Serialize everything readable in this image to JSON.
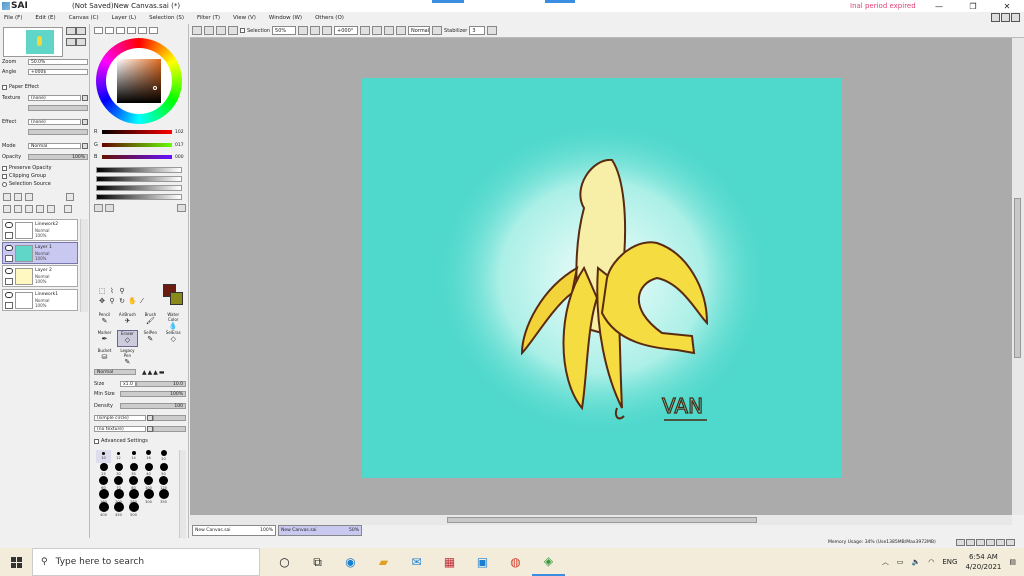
{
  "app": {
    "brand": "SAI",
    "title": "(Not Saved)New Canvas.sai (*)",
    "trial_notice": "Inal period expired",
    "min": "—",
    "max": "❐",
    "close": "✕"
  },
  "menu": [
    "File (F)",
    "Edit (E)",
    "Canvas (C)",
    "Layer (L)",
    "Selection (S)",
    "Filter (T)",
    "View (V)",
    "Window (W)",
    "Others (O)"
  ],
  "navigator": {
    "zoom_label": "Zoom",
    "zoom_value": "50.0%",
    "angle_label": "Angle",
    "angle_value": "+000$"
  },
  "paper_effect": {
    "header": "Paper Effect",
    "texture_label": "Texture",
    "texture_value": "(none)",
    "effect_label": "Effect",
    "effect_value": "(none)"
  },
  "layer_props": {
    "mode_label": "Mode",
    "mode_value": "Normal",
    "opacity_label": "Opacity",
    "opacity_value": "100%",
    "preserve_opacity": "Preserve Opacity",
    "clipping_group": "Clipping Group",
    "selection_source": "Selection Source"
  },
  "layers": [
    {
      "name": "Linework2",
      "mode": "Normal",
      "opacity": "100%",
      "selected": false
    },
    {
      "name": "Layer 1",
      "mode": "Normal",
      "opacity": "100%",
      "selected": true
    },
    {
      "name": "Layer 2",
      "mode": "Normal",
      "opacity": "100%",
      "selected": false
    },
    {
      "name": "Linework1",
      "mode": "Normal",
      "opacity": "100%",
      "selected": false
    }
  ],
  "color": {
    "r_label": "R",
    "r_value": "102",
    "g_label": "G",
    "g_value": "017",
    "b_label": "B",
    "b_value": "000",
    "foreground": "#6b1c10",
    "background": "#8a8a1a"
  },
  "brushes": [
    {
      "name": "Pencil",
      "icon": "✎"
    },
    {
      "name": "AirBrush",
      "icon": "✈"
    },
    {
      "name": "Brush",
      "icon": "🖌"
    },
    {
      "name": "Water Color",
      "icon": "💧"
    },
    {
      "name": "Marker",
      "icon": "✒"
    },
    {
      "name": "Eraser",
      "icon": "◇",
      "selected": true
    },
    {
      "name": "SelPen",
      "icon": "✎"
    },
    {
      "name": "SelEras",
      "icon": "◇"
    },
    {
      "name": "Bucket",
      "icon": "⛁"
    },
    {
      "name": "Legacy Pen",
      "icon": "✎"
    }
  ],
  "brush_settings": {
    "blend_value": "Normal",
    "size_label": "Size",
    "size_mult": "x1.0",
    "size_value": "10.0",
    "minsize_label": "Min Size",
    "minsize_value": "100%",
    "density_label": "Density",
    "density_value": "100",
    "circle_value": "(simple circle)",
    "texture_value": "(no texture)",
    "advanced_label": "Advanced Settings"
  },
  "brush_sizes": [
    "10",
    "12",
    "14",
    "16",
    "20",
    "25",
    "30",
    "35",
    "40",
    "50",
    "60",
    "70",
    "80",
    "100",
    "120",
    "160",
    "200",
    "250",
    "300",
    "350",
    "400",
    "450",
    "500"
  ],
  "toolbar": {
    "selection_label": "Selection",
    "zoom_value": "50%",
    "angle_value": "+000°",
    "mode_value": "Normal",
    "stabilizer_label": "Stabilizer",
    "stabilizer_value": "3"
  },
  "artwork": {
    "signature": "VAN",
    "bg_color": "#4fd8cc"
  },
  "tabs": [
    {
      "name": "New Canvas.sai",
      "zoom": "100%",
      "active": false
    },
    {
      "name": "New Canvas.sai",
      "zoom": "50%",
      "active": true
    }
  ],
  "status": {
    "memory": "Memory Usage: 34% (Use1385MB/Max3972MB)"
  },
  "taskbar": {
    "search_placeholder": "Type here to search",
    "language": "ENG",
    "time": "6:54 AM",
    "date": "4/20/2021"
  }
}
